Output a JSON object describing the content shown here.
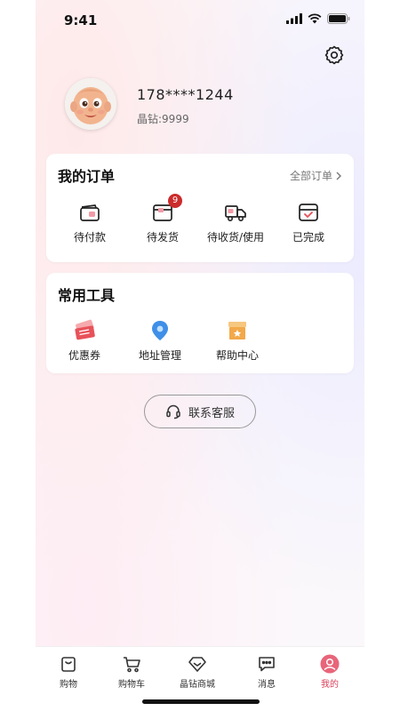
{
  "status_bar": {
    "time": "9:41"
  },
  "profile": {
    "phone": "178****1244",
    "diamonds": "晶钻:9999"
  },
  "orders": {
    "title": "我的订单",
    "all_label": "全部订单",
    "items": [
      {
        "label": "待付款",
        "icon": "wallet-icon"
      },
      {
        "label": "待发货",
        "icon": "package-icon",
        "badge": "9"
      },
      {
        "label": "待收货/使用",
        "icon": "truck-icon"
      },
      {
        "label": "已完成",
        "icon": "calendar-check-icon"
      }
    ]
  },
  "tools": {
    "title": "常用工具",
    "items": [
      {
        "label": "优惠券",
        "icon": "coupon-icon"
      },
      {
        "label": "地址管理",
        "icon": "location-pin-icon"
      },
      {
        "label": "帮助中心",
        "icon": "help-box-icon"
      }
    ]
  },
  "customer_service": {
    "label": "联系客服",
    "icon": "headset-icon"
  },
  "tabbar": {
    "items": [
      {
        "label": "购物",
        "icon": "shopping-bag-icon"
      },
      {
        "label": "购物车",
        "icon": "cart-icon"
      },
      {
        "label": "晶钻商城",
        "icon": "diamond-icon"
      },
      {
        "label": "消息",
        "icon": "message-icon"
      },
      {
        "label": "我的",
        "icon": "profile-icon",
        "active": true
      }
    ]
  },
  "colors": {
    "accent": "#d9415a",
    "badge": "#cc2b2b",
    "location_blue": "#3f8fe8",
    "help_orange": "#f2a94a",
    "coupon_red": "#e8525a"
  }
}
